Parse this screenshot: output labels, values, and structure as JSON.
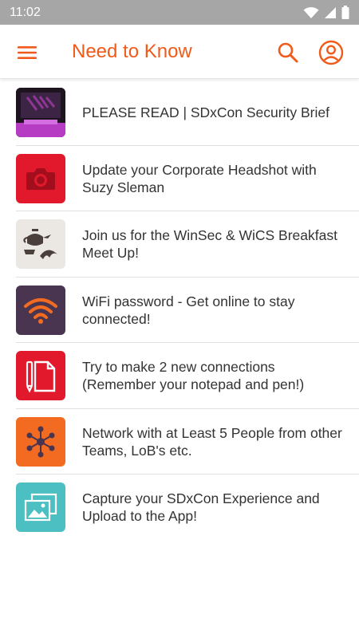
{
  "status_bar": {
    "time": "11:02"
  },
  "app_bar": {
    "title": "Need to Know"
  },
  "items": [
    {
      "title": "PLEASE READ | SDxCon Security Brief",
      "icon": "laptop-photo-icon"
    },
    {
      "title": "Update your Corporate Headshot with Suzy Sleman",
      "icon": "camera-icon"
    },
    {
      "title": "Join us for the WinSec & WiCS Breakfast Meet Up!",
      "icon": "teapot-croissant-icon"
    },
    {
      "title": "WiFi password - Get online to stay connected!",
      "icon": "wifi-icon"
    },
    {
      "title": "Try to make 2 new connections (Remember your notepad and pen!)",
      "icon": "notepad-pen-icon"
    },
    {
      "title": "Network with at Least 5 People from other Teams, LoB's etc.",
      "icon": "network-icon"
    },
    {
      "title": "Capture your SDxCon Experience and Upload to the App!",
      "icon": "photo-gallery-icon"
    }
  ],
  "colors": {
    "accent": "#f05a1a",
    "status_bar": "#a6a6a6",
    "camera_bg": "#e2192c",
    "breakfast_bg": "#ebe7e3",
    "wifi_bg": "#4a3550",
    "notepad_bg": "#e2192c",
    "network_bg": "#f36b21",
    "gallery_bg": "#4bbfc1"
  }
}
